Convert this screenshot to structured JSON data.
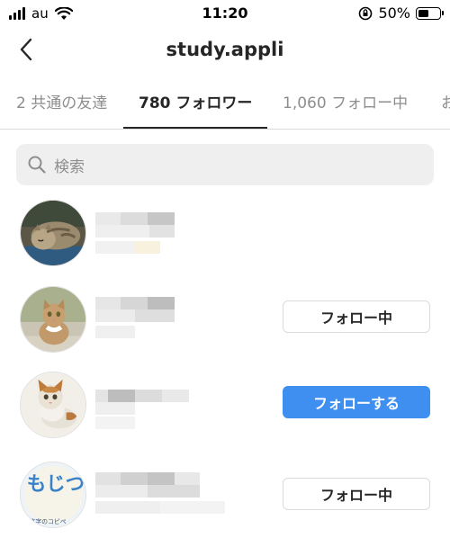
{
  "status_bar": {
    "carrier": "au",
    "time": "11:20",
    "battery_percent": "50%",
    "battery_level": 0.5,
    "icons": [
      "signal-icon",
      "wifi-icon",
      "orientation-lock-icon",
      "battery-icon"
    ]
  },
  "header": {
    "title": "study.appli",
    "back_icon": "chevron-left-icon"
  },
  "tabs": [
    {
      "label": "2 共通の友達"
    },
    {
      "label": "780 フォロワー"
    },
    {
      "label": "1,060 フォロー中"
    },
    {
      "label": "お"
    }
  ],
  "active_tab": 1,
  "search": {
    "placeholder": "検索"
  },
  "followers": [
    {
      "avatar": "sleeping-cat-photo",
      "button": ""
    },
    {
      "avatar": "sitting-cat-photo",
      "button": "フォロー中"
    },
    {
      "avatar": "kitten-photo",
      "button": "フォローする"
    },
    {
      "avatar": "mojitsuku-logo",
      "button": "フォロー中",
      "avatar_text": "もじつく",
      "avatar_subtext": "文字のコピペ"
    }
  ],
  "colors": {
    "follow_button": "#3f8ff0",
    "text_primary": "#262626",
    "text_secondary": "#8e8e8e"
  }
}
